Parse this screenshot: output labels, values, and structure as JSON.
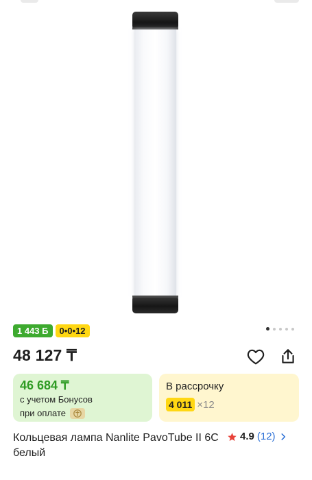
{
  "product": {
    "badges": {
      "bonus": "1 443 Б",
      "installment": "0•0•12"
    },
    "gallery": {
      "total_images": 5,
      "active_index": 0
    },
    "price": "48 127 ₸",
    "bonus_card": {
      "price": "46 684 ₸",
      "line1": "с учетом Бонусов",
      "line2": "при оплате"
    },
    "installment_card": {
      "title": "В рассрочку",
      "amount": "4 011",
      "months": "×12"
    },
    "title": "Кольцевая лампа Nanlite PavoTube II 6C белый",
    "rating": {
      "value": "4.9",
      "count": "(12)"
    }
  },
  "colors": {
    "bonus_green": "#3daa2f",
    "installment_yellow": "#ffd713",
    "bonus_card_bg": "#dff5d3",
    "installment_card_bg": "#fff6cf",
    "link_blue": "#2a6fd6",
    "star_red": "#e8423a"
  },
  "icons": {
    "favorite": "heart-outline-icon",
    "share": "share-icon",
    "rating": "star-icon",
    "chevron": "chevron-right-icon",
    "kaspi": "kaspi-logo-icon"
  }
}
